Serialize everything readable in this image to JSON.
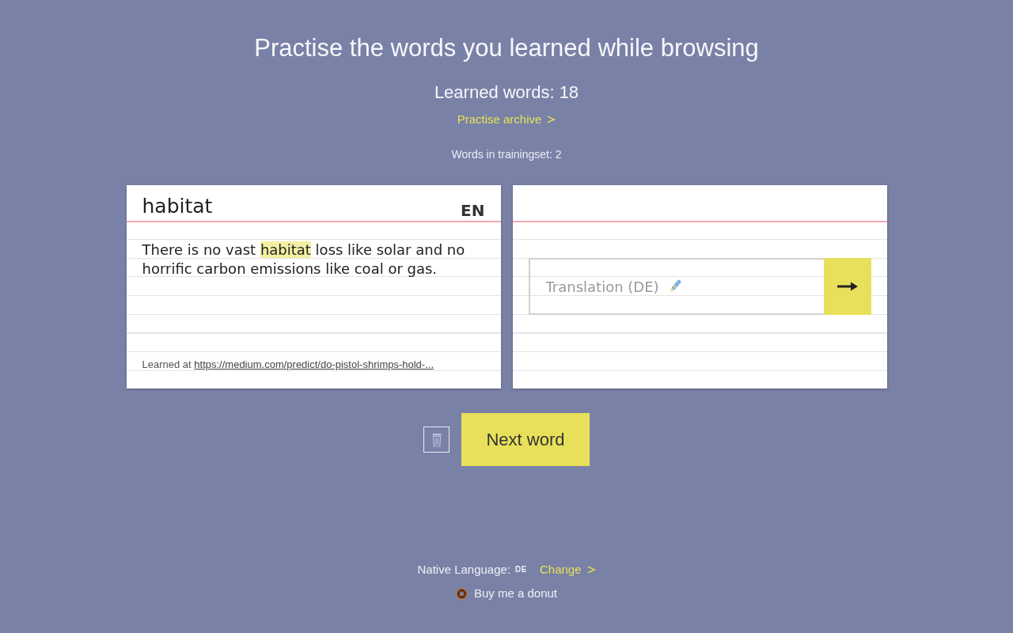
{
  "header": {
    "title": "Practise the words you learned while browsing",
    "learned_words": "Learned words: 18",
    "archive_link": "Practise archive",
    "trainingset": "Words in trainingset: 2"
  },
  "word_card": {
    "word": "habitat",
    "language": "EN",
    "sentence": {
      "before": "There is no vast ",
      "highlight": "habitat",
      "after": " loss like solar and no horrific carbon emissions like coal or gas."
    },
    "source_label": "Learned at",
    "source_link": "https://medium.com/predict/do-pistol-shrimps-hold-..."
  },
  "answer_card": {
    "placeholder": "Translation (DE)"
  },
  "actions": {
    "next_button": "Next word"
  },
  "footer": {
    "native_language_label": "Native Language:",
    "native_language": "DE",
    "change_link": "Change",
    "donate_link": "Buy me a donut"
  }
}
